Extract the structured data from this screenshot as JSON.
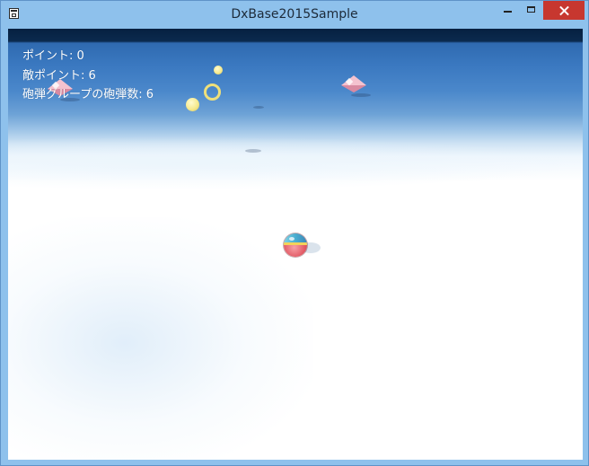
{
  "window": {
    "title": "DxBase2015Sample"
  },
  "hud": {
    "points": "ポイント: 0",
    "enemy_points": "敵ポイント: 6",
    "shell_group_count": "砲弾グループの砲弾数: 6"
  },
  "colors": {
    "titlebar": "#8ec1ec",
    "close_button": "#c7372f",
    "hud_text": "#ffffff",
    "enemy_gem": "#f4c2cf",
    "shell": "#f6ea8e",
    "player_body": "#e0545f",
    "player_cap": "#4aaed0"
  },
  "icons": {
    "app": "app-window-icon",
    "minimize": "minimize-icon",
    "maximize": "maximize-icon",
    "close": "close-icon"
  }
}
